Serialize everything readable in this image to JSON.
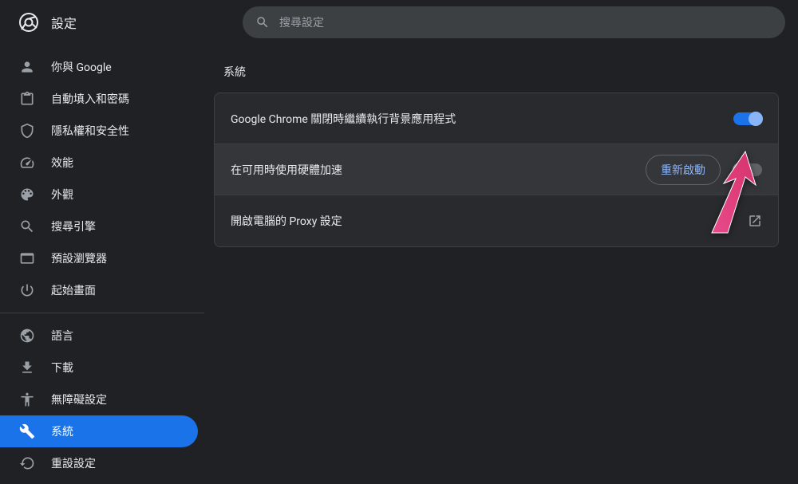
{
  "header": {
    "title": "設定",
    "search_placeholder": "搜尋設定"
  },
  "sidebar": {
    "items": [
      {
        "icon": "person",
        "label": "你與 Google"
      },
      {
        "icon": "clipboard",
        "label": "自動填入和密碼"
      },
      {
        "icon": "shield",
        "label": "隱私權和安全性"
      },
      {
        "icon": "speed",
        "label": "效能"
      },
      {
        "icon": "palette",
        "label": "外觀"
      },
      {
        "icon": "search",
        "label": "搜尋引擎"
      },
      {
        "icon": "browser",
        "label": "預設瀏覽器"
      },
      {
        "icon": "power",
        "label": "起始畫面"
      }
    ],
    "items2": [
      {
        "icon": "globe",
        "label": "語言"
      },
      {
        "icon": "download",
        "label": "下載"
      },
      {
        "icon": "accessibility",
        "label": "無障礙設定"
      },
      {
        "icon": "wrench",
        "label": "系統",
        "active": true
      },
      {
        "icon": "reset",
        "label": "重設設定"
      }
    ]
  },
  "main": {
    "section_title": "系統",
    "rows": [
      {
        "label": "Google Chrome 關閉時繼續執行背景應用程式",
        "toggle": "on"
      },
      {
        "label": "在可用時使用硬體加速",
        "toggle": "off",
        "restart_label": "重新啟動",
        "highlighted": true
      },
      {
        "label": "開啟電腦的 Proxy 設定",
        "external": true
      }
    ]
  }
}
